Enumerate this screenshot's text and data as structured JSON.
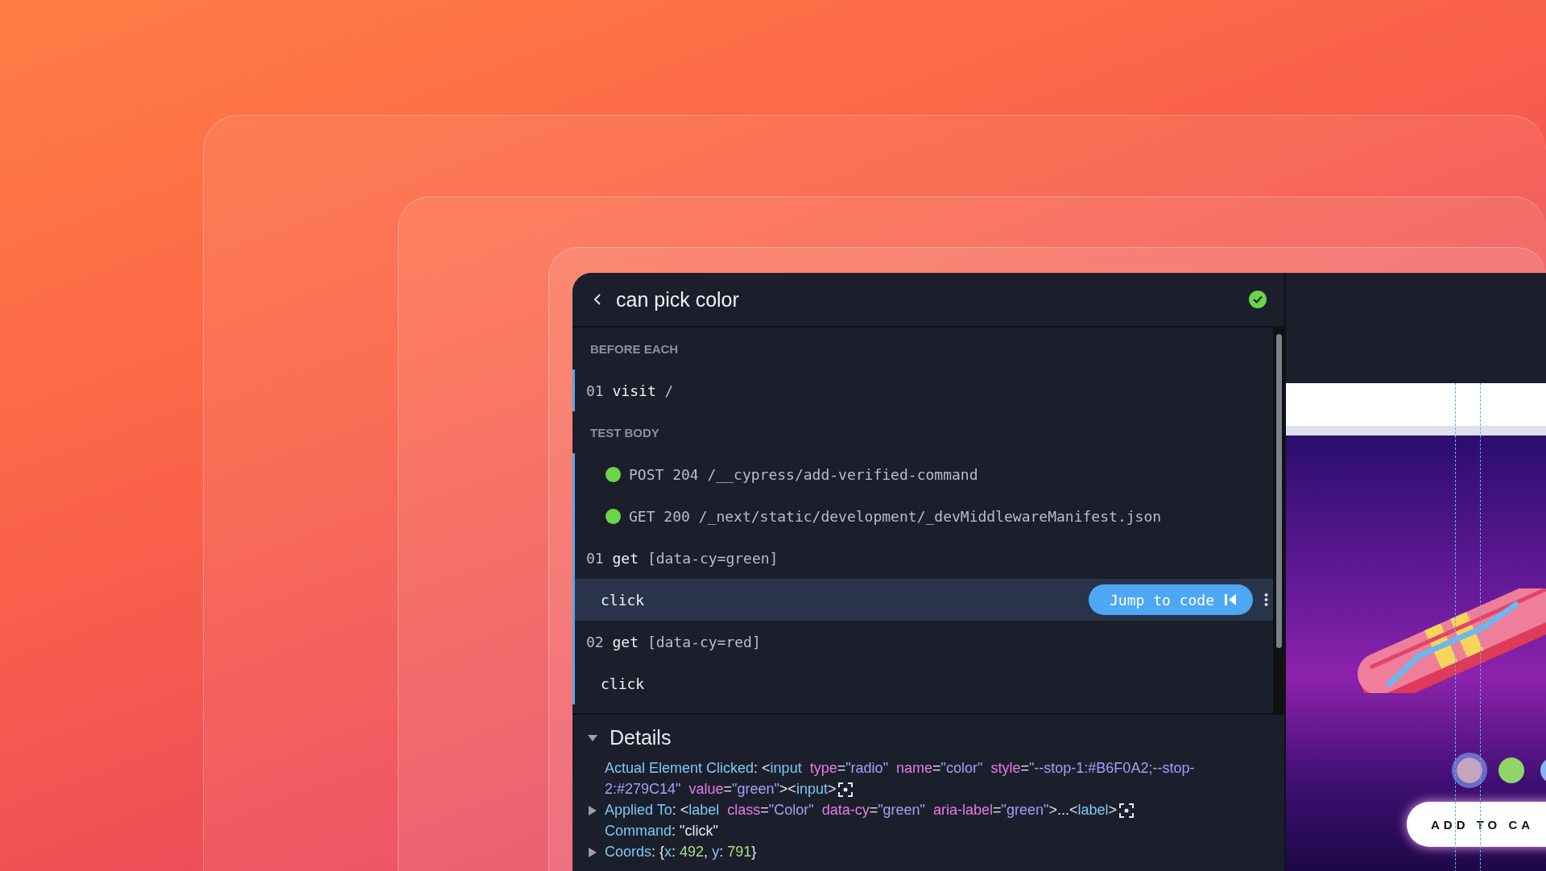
{
  "header": {
    "title": "can pick color",
    "passed": true
  },
  "sections": [
    {
      "label": "BEFORE EACH",
      "commands": [
        {
          "kind": "command",
          "number": "01",
          "name": "visit",
          "message": "/",
          "selected": false
        }
      ]
    },
    {
      "label": "TEST BODY",
      "commands": [
        {
          "kind": "request",
          "name": "POST 204",
          "message": "/__cypress/add-verified-command",
          "color": "#6cd44a",
          "selected": false
        },
        {
          "kind": "request",
          "name": "GET 200",
          "message": "/_next/static/development/_devMiddlewareManifest.json",
          "color": "#6cd44a",
          "selected": false
        },
        {
          "kind": "command",
          "number": "01",
          "name": "get",
          "message": "[data-cy=green]",
          "selected": false
        },
        {
          "kind": "child",
          "name": "click",
          "selected": true,
          "action": "Jump to code"
        },
        {
          "kind": "command",
          "number": "02",
          "name": "get",
          "message": "[data-cy=red]",
          "selected": false
        },
        {
          "kind": "child",
          "name": "click",
          "selected": false
        }
      ]
    }
  ],
  "details": {
    "title": "Details",
    "expanded": true,
    "lines": [
      {
        "expandable": false,
        "target": true,
        "tokens": [
          {
            "kind": "key",
            "text": "Actual Element Clicked"
          },
          {
            "kind": "plain",
            "text": ": <"
          },
          {
            "kind": "tag",
            "text": "input"
          },
          {
            "kind": "attr",
            "text": "type"
          },
          {
            "kind": "plain",
            "text": "="
          },
          {
            "kind": "value",
            "text": "\"radio\""
          },
          {
            "kind": "attr",
            "text": "name"
          },
          {
            "kind": "plain",
            "text": "="
          },
          {
            "kind": "value",
            "text": "\"color\""
          },
          {
            "kind": "attr",
            "text": "style"
          },
          {
            "kind": "plain",
            "text": "="
          },
          {
            "kind": "value",
            "text": "\"--stop-1:#B6F0A2;--stop-2:#279C14\""
          },
          {
            "kind": "attr",
            "text": "value"
          },
          {
            "kind": "plain",
            "text": "="
          },
          {
            "kind": "value",
            "text": "\"green\""
          },
          {
            "kind": "plain",
            "text": "><"
          },
          {
            "kind": "tag",
            "text": "input"
          },
          {
            "kind": "plain",
            "text": ">"
          }
        ]
      },
      {
        "expandable": true,
        "target": true,
        "tokens": [
          {
            "kind": "key",
            "text": "Applied To"
          },
          {
            "kind": "plain",
            "text": ": <"
          },
          {
            "kind": "tag",
            "text": "label"
          },
          {
            "kind": "attr",
            "text": "class"
          },
          {
            "kind": "plain",
            "text": "="
          },
          {
            "kind": "value",
            "text": "\"Color\""
          },
          {
            "kind": "attr",
            "text": "data-cy"
          },
          {
            "kind": "plain",
            "text": "="
          },
          {
            "kind": "value",
            "text": "\"green\""
          },
          {
            "kind": "attr",
            "text": "aria-label"
          },
          {
            "kind": "plain",
            "text": "="
          },
          {
            "kind": "value",
            "text": "\"green\""
          },
          {
            "kind": "plain",
            "text": ">...<"
          },
          {
            "kind": "tag",
            "text": "label"
          },
          {
            "kind": "plain",
            "text": ">"
          }
        ]
      },
      {
        "expandable": false,
        "target": false,
        "tokens": [
          {
            "kind": "key",
            "text": "Command"
          },
          {
            "kind": "plain",
            "text": ": \"click\""
          }
        ]
      },
      {
        "expandable": true,
        "target": false,
        "tokens": [
          {
            "kind": "key",
            "text": "Coords"
          },
          {
            "kind": "plain",
            "text": ": {"
          },
          {
            "kind": "key",
            "text": "x"
          },
          {
            "kind": "plain",
            "text": ": "
          },
          {
            "kind": "number",
            "text": "492"
          },
          {
            "kind": "plain",
            "text": ", "
          },
          {
            "kind": "key",
            "text": "y"
          },
          {
            "kind": "plain",
            "text": ": "
          },
          {
            "kind": "number",
            "text": "791"
          },
          {
            "kind": "plain",
            "text": "}"
          }
        ]
      }
    ]
  },
  "preview": {
    "swatches": [
      {
        "color": "#c4a6bd",
        "highlighted": true
      },
      {
        "color": "#8fd66a",
        "highlighted": false
      },
      {
        "color": "#8ab4f0",
        "highlighted": false
      }
    ],
    "cart_button": "ADD TO CA"
  }
}
